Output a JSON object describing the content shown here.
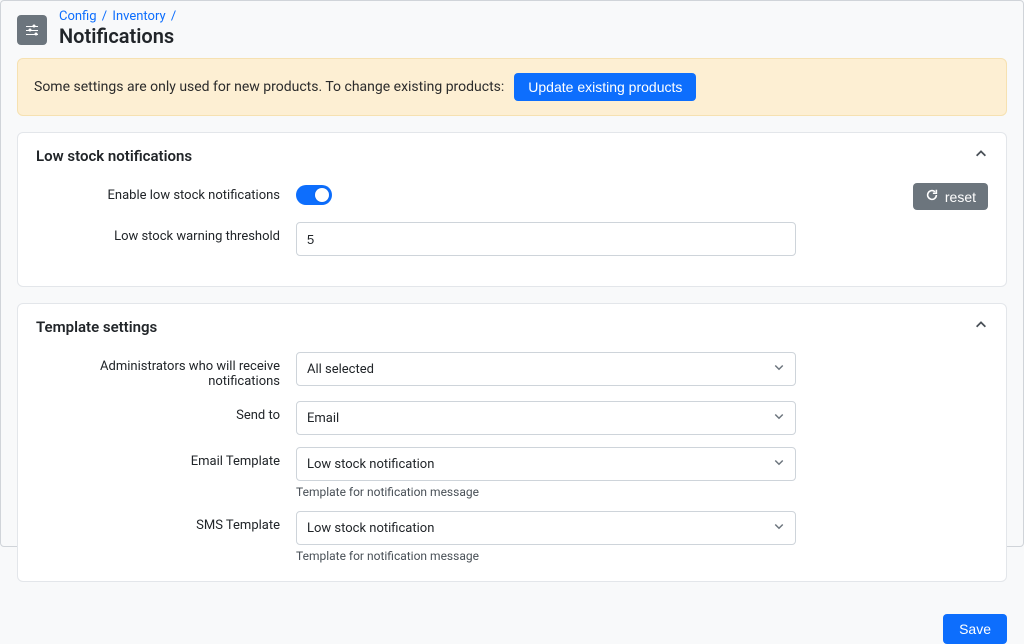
{
  "breadcrumb": {
    "config": "Config",
    "inventory": "Inventory"
  },
  "page_title": "Notifications",
  "notice": {
    "text": "Some settings are only used for new products. To change existing products:",
    "button": "Update existing products"
  },
  "panel_low_stock": {
    "title": "Low stock notifications",
    "enable_label": "Enable low stock notifications",
    "reset_label": "reset",
    "threshold_label": "Low stock warning threshold",
    "threshold_value": "5"
  },
  "panel_template": {
    "title": "Template settings",
    "admins_label": "Administrators who will receive notifications",
    "admins_value": "All selected",
    "send_to_label": "Send to",
    "send_to_value": "Email",
    "email_template_label": "Email Template",
    "email_template_value": "Low stock notification",
    "email_template_help": "Template for notification message",
    "sms_template_label": "SMS Template",
    "sms_template_value": "Low stock notification",
    "sms_template_help": "Template for notification message"
  },
  "footer": {
    "save": "Save"
  }
}
